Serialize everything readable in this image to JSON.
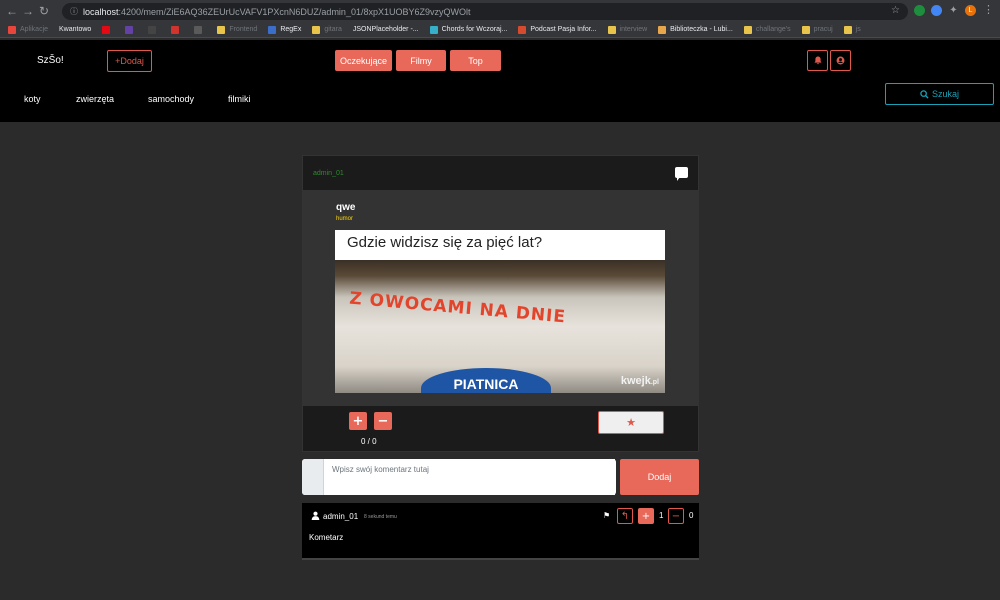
{
  "browser": {
    "url_host": "localhost",
    "url_rest": ":4200/mem/ZiE6AQ36ZEUrUcVAFV1PXcnN6DUZ/admin_01/8xpX1UOBY6Z9vzyQWOlt",
    "bookmarks": [
      {
        "label": "Aplikacje",
        "color": "#e8453c",
        "dim": true
      },
      {
        "label": "Kwantowo",
        "color": "",
        "dim": false
      },
      {
        "label": "",
        "color": "#e50914",
        "dim": false
      },
      {
        "label": "",
        "color": "#6441a5",
        "dim": false
      },
      {
        "label": "",
        "color": "#444444",
        "dim": false
      },
      {
        "label": "",
        "color": "#d0342c",
        "dim": false
      },
      {
        "label": "",
        "color": "#5a5a5a",
        "dim": false
      },
      {
        "label": "Frontend",
        "color": "#e8c44b",
        "dim": true
      },
      {
        "label": "RegEx",
        "color": "#3b6ec8",
        "dim": false
      },
      {
        "label": "gitara",
        "color": "#e8c44b",
        "dim": true
      },
      {
        "label": "JSONPlaceholder -...",
        "color": "",
        "dim": false
      },
      {
        "label": "Chords for Wczoraj...",
        "color": "#35b0c8",
        "dim": false
      },
      {
        "label": "Podcast Pasja Infor...",
        "color": "#d64a2e",
        "dim": false
      },
      {
        "label": "interview",
        "color": "#e8c44b",
        "dim": true
      },
      {
        "label": "Biblioteczka - Lubi...",
        "color": "#e8a64b",
        "dim": false
      },
      {
        "label": "challange's",
        "color": "#e8c44b",
        "dim": true
      },
      {
        "label": "pracuj",
        "color": "#e8c44b",
        "dim": true
      },
      {
        "label": "js",
        "color": "#e8c44b",
        "dim": true
      }
    ]
  },
  "navbar": {
    "brand": "SzŠo!",
    "add_label": "+Dodaj",
    "center_buttons": [
      "Oczekujące",
      "Filmy",
      "Top"
    ],
    "categories": [
      "koty",
      "zwierzęta",
      "samochody",
      "filmiki"
    ],
    "search_label": "Szukaj"
  },
  "post": {
    "author": "admin_01",
    "title": "qwe",
    "tag": "humor",
    "caption": "Gdzie widzisz się za pięć lat?",
    "cup_text": "Z OWOCAMI NA DNIE",
    "brand_text": "PIATNICA",
    "watermark": "kwejk",
    "watermark_suffix": ".pl",
    "plus": "+",
    "minus": "−",
    "votes": "0 / 0"
  },
  "comment_form": {
    "placeholder": "Wpisz swój komentarz tutaj",
    "submit": "Dodaj"
  },
  "comments": [
    {
      "user": "admin_01",
      "time": "8 sekund temu",
      "text": "Kometarz",
      "plus_count": "1",
      "minus_count": "0"
    }
  ],
  "colors": {
    "accent": "#e8685a",
    "search": "#17a2b8",
    "tag": "#ffd700",
    "author": "#2e8b2e"
  }
}
